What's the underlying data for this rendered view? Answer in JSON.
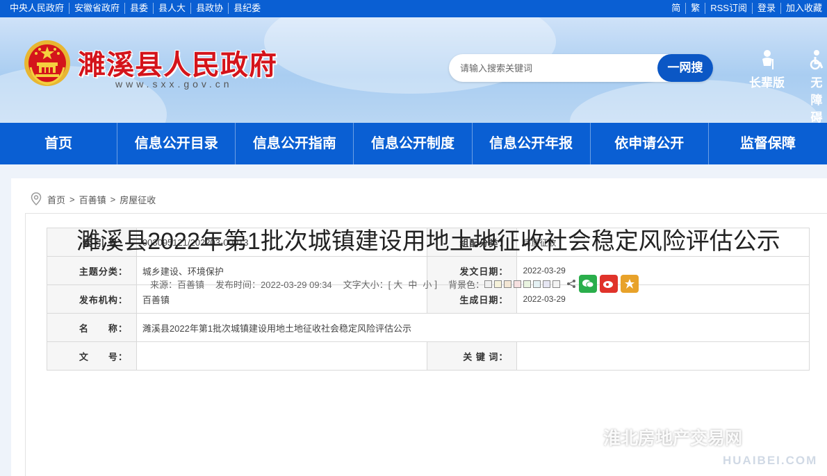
{
  "topbar": {
    "left_links": [
      "中央人民政府",
      "安徽省政府",
      "县委",
      "县人大",
      "县政协",
      "县纪委"
    ],
    "right_links": [
      "简",
      "繁",
      "RSS订阅",
      "登录",
      "加入收藏"
    ]
  },
  "header": {
    "site_title": "濉溪县人民政府",
    "site_url": "www.sxx.gov.cn",
    "search_placeholder": "请输入搜索关键词",
    "search_button": "一网搜",
    "elder_mode": "长辈版",
    "accessibility": "无障碍"
  },
  "nav": [
    "首页",
    "信息公开目录",
    "信息公开指南",
    "信息公开制度",
    "信息公开年报",
    "依申请公开",
    "监督保障"
  ],
  "breadcrumb": [
    "首页",
    "百善镇",
    "房屋征收"
  ],
  "meta": {
    "index_label": "索 引 号：",
    "index_value": "003095121/202203-00013",
    "category_label": "组配分类：",
    "category_value": "房屋征收",
    "topic_label": "主题分类：",
    "topic_value": "城乡建设、环境保护",
    "issue_date_label": "发文日期：",
    "issue_date_value": "2022-03-29",
    "publisher_label": "发布机构：",
    "publisher_value": "百善镇",
    "created_date_label": "生成日期：",
    "created_date_value": "2022-03-29",
    "name_label": "名　　称：",
    "name_value": "濉溪县2022年第1批次城镇建设用地土地征收社会稳定风险评估公示",
    "docno_label": "文　　号：",
    "docno_value": "",
    "keywords_label": "关 键 词：",
    "keywords_value": ""
  },
  "article": {
    "title": "濉溪县2022年第1批次城镇建设用地土地征收社会稳定风险评估公示",
    "source": "来源：百善镇",
    "publish_time": "发布时间：2022-03-29 09:34",
    "font_size_label": "文字大小：[",
    "font_sizes": [
      "大",
      "中",
      "小"
    ],
    "font_size_close": "]",
    "bg_color_label": "背景色：",
    "bg_colors": [
      "#efefef",
      "#f6f2da",
      "#f3e6d4",
      "#f6e0e0",
      "#e9f4e0",
      "#e4f1f4",
      "#e6e6f3",
      "#f3f3f3"
    ]
  },
  "watermark": {
    "text": "淮北房地产交易网",
    "subtext": "HUAIBEI.COM"
  }
}
